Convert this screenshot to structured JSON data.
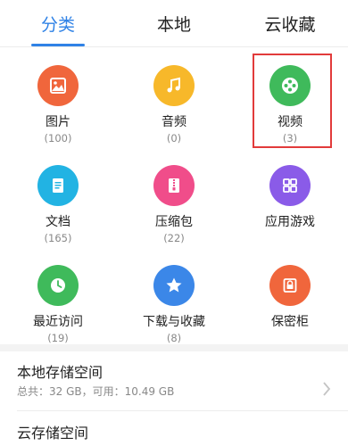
{
  "tabs": [
    {
      "label": "分类",
      "active": true
    },
    {
      "label": "本地",
      "active": false
    },
    {
      "label": "云收藏",
      "active": false
    }
  ],
  "categories": [
    {
      "label": "图片",
      "count": "(100)",
      "icon": "image-icon",
      "color": "#f0663c"
    },
    {
      "label": "音频",
      "count": "(0)",
      "icon": "music-icon",
      "color": "#f7b82a"
    },
    {
      "label": "视频",
      "count": "(3)",
      "icon": "video-reel-icon",
      "color": "#3fba5b"
    },
    {
      "label": "文档",
      "count": "(165)",
      "icon": "document-icon",
      "color": "#22b3e3"
    },
    {
      "label": "压缩包",
      "count": "(22)",
      "icon": "archive-icon",
      "color": "#f04d8a"
    },
    {
      "label": "应用游戏",
      "count": "",
      "icon": "apps-grid-icon",
      "color": "#8a5be8"
    },
    {
      "label": "最近访问",
      "count": "(19)",
      "icon": "clock-icon",
      "color": "#3fba5b"
    },
    {
      "label": "下载与收藏",
      "count": "(8)",
      "icon": "star-icon",
      "color": "#3b87e8"
    },
    {
      "label": "保密柜",
      "count": "",
      "icon": "lock-icon",
      "color": "#f0663c"
    }
  ],
  "highlight_color": "#e23b3b",
  "accent": "#2f82e6",
  "storage": {
    "local_title": "本地存储空间",
    "local_sub": "总共：32 GB，可用：10.49 GB",
    "cloud_title": "云存储空间"
  }
}
